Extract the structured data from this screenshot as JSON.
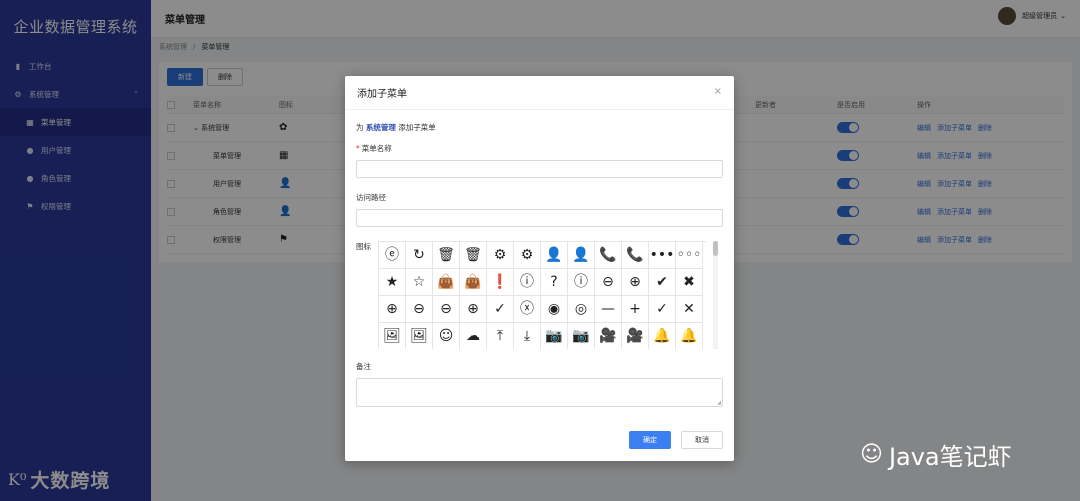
{
  "sidebar": {
    "brand": "企业数据管理系统",
    "items": [
      {
        "label": "工作台",
        "icon": "bar-chart-icon"
      },
      {
        "label": "系统管理",
        "icon": "gear-icon"
      },
      {
        "label": "菜单管理",
        "icon": "grid-icon"
      },
      {
        "label": "用户管理",
        "icon": "user-icon"
      },
      {
        "label": "角色管理",
        "icon": "user-icon"
      },
      {
        "label": "权限管理",
        "icon": "flag-icon"
      }
    ],
    "footer": "大数跨境"
  },
  "header": {
    "title": "菜单管理",
    "user": "超级管理员"
  },
  "breadcrumb": [
    "系统管理",
    "/",
    "菜单管理"
  ],
  "toolbar": {
    "new_label": "新建",
    "delete_label": "删除"
  },
  "table": {
    "headers": [
      "菜单名称",
      "图标",
      "更新者",
      "是否启用",
      "操作"
    ],
    "rows": [
      {
        "name": "系统管理",
        "icon": "✿"
      },
      {
        "name": "菜单管理",
        "icon": "▦"
      },
      {
        "name": "用户管理",
        "icon": "👤"
      },
      {
        "name": "角色管理",
        "icon": "👤"
      },
      {
        "name": "权限管理",
        "icon": "⚑"
      }
    ],
    "ops": [
      "编辑",
      "添加子菜单",
      "删除"
    ]
  },
  "modal": {
    "title": "添加子菜单",
    "close": "×",
    "note_prefix": "为",
    "note_parent": "系统管理",
    "note_suffix": "添加子菜单",
    "name_label": "菜单名称",
    "name_required": "*",
    "path_label": "访问路径",
    "icon_label": "图标",
    "remark_label": "备注",
    "confirm_label": "确定",
    "cancel_label": "取消",
    "icons": [
      "ⓔ",
      "↻",
      "🗑",
      "🗑",
      "⚙",
      "⚙",
      "👤",
      "👤",
      "📞",
      "📞",
      "•••",
      "◦◦◦",
      "★",
      "☆",
      "👜",
      "👜",
      "❗",
      "ⓘ",
      "?",
      "ⓘ",
      "⊖",
      "⊕",
      "✔",
      "✖",
      "⊕",
      "⊖",
      "⊖",
      "⊕",
      "✓",
      "ⓧ",
      "◉",
      "◎",
      "—",
      "+",
      "✓",
      "✕",
      "🖼",
      "🖼",
      "☺",
      "☁",
      "⤒",
      "⤓",
      "📷",
      "📷",
      "🎥",
      "🎥",
      "🔔",
      "🔔"
    ]
  },
  "watermark": "Java笔记虾"
}
